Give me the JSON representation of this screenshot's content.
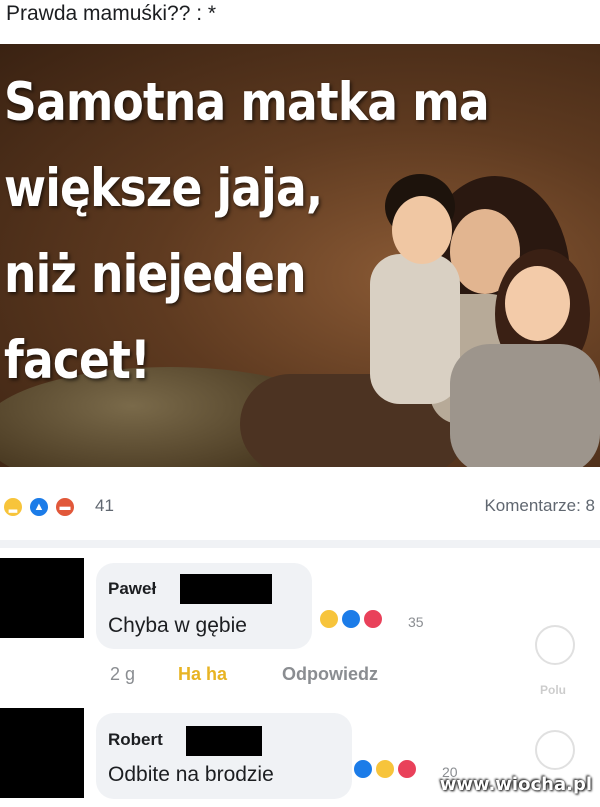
{
  "post": {
    "caption": "Prawda mamuśki?? : *",
    "image_text": [
      "Samotna matka ma",
      "większe jaja,",
      "niż niejeden",
      "facet!"
    ]
  },
  "reactions": {
    "icons": [
      "haha-emoji-icon",
      "like-emoji-icon",
      "angry-emoji-icon"
    ],
    "count": "41",
    "comments_label": "Komentarze: 8"
  },
  "comments": [
    {
      "author": "Paweł",
      "text": "Chyba w gębie",
      "reaction_icons": [
        "haha-emoji-icon",
        "like-emoji-icon",
        "love-emoji-icon"
      ],
      "reaction_count": "35",
      "time": "2 g",
      "reacted_label": "Ha ha",
      "reply_label": "Odpowiedz"
    },
    {
      "author": "Robert",
      "text": "Odbite na brodzie",
      "reaction_icons": [
        "like-emoji-icon",
        "haha-emoji-icon",
        "love-emoji-icon"
      ],
      "reaction_count": "20"
    }
  ],
  "side_actions": {
    "like_label": "Polu"
  },
  "watermark": "www.wiocha.pl",
  "colors": {
    "haha": "#f7c43b",
    "like": "#1c7ce8",
    "angry": "#e1583a",
    "love": "#e9415a",
    "meta_gray": "#8a8d91"
  }
}
